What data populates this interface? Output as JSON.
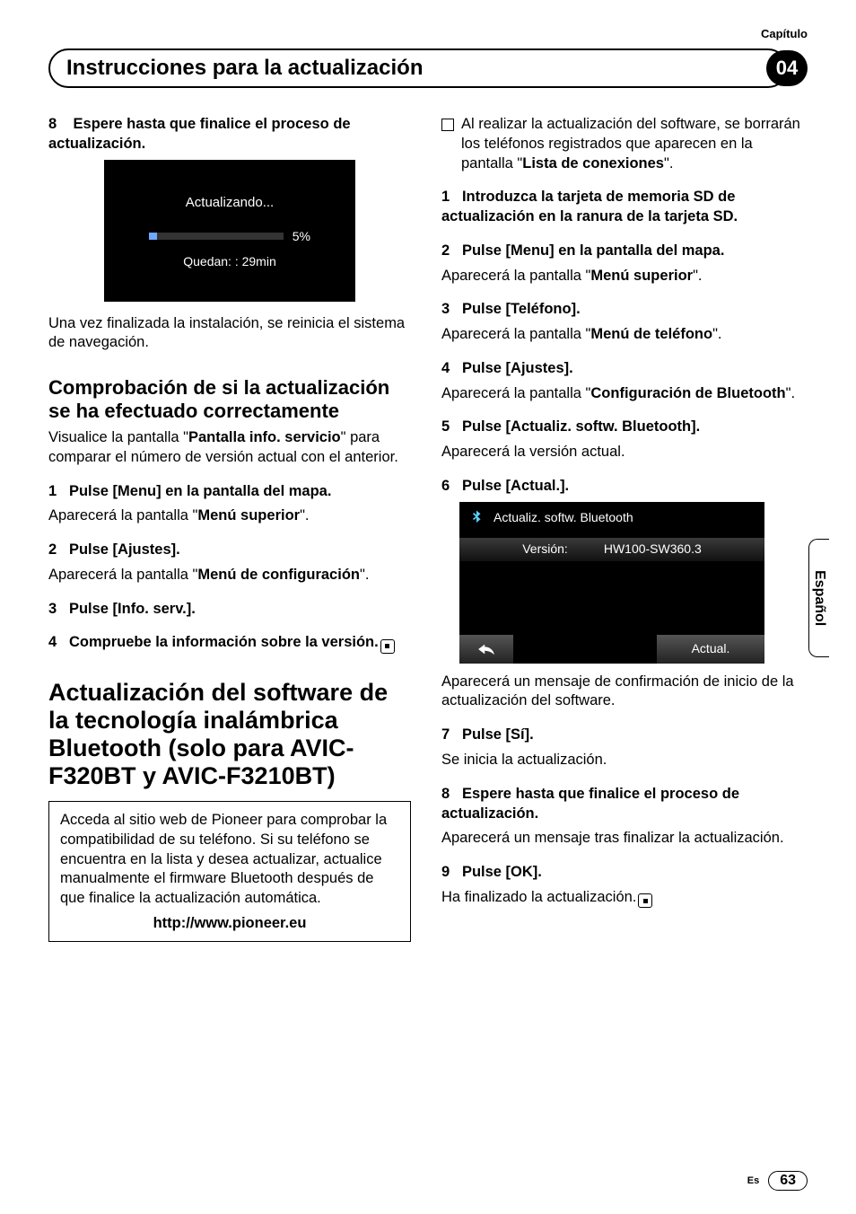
{
  "meta": {
    "capitulo_label": "Capítulo",
    "chapter_num": "04",
    "lang_tab": "Español",
    "footer_lang": "Es",
    "page_num": "63"
  },
  "header": {
    "title": "Instrucciones para la actualización"
  },
  "left": {
    "step8": {
      "num": "8",
      "title": "Espere hasta que finalice el proceso de actualización."
    },
    "shot1": {
      "updating": "Actualizando...",
      "percent": "5%",
      "remaining": "Quedan:  :  29min"
    },
    "after_shot1": "Una vez finalizada la instalación, se reinicia el sistema de navegación.",
    "h2": "Comprobación de si la actualización se ha efectuado correctamente",
    "h2_desc_a": "Visualice la pantalla \"",
    "h2_desc_b": "Pantalla info. servicio",
    "h2_desc_c": "\" para comparar el número de versión actual con el anterior.",
    "s1": {
      "num": "1",
      "title": "Pulse [Menu] en la pantalla del mapa.",
      "sub_a": "Aparecerá la pantalla \"",
      "sub_b": "Menú superior",
      "sub_c": "\"."
    },
    "s2": {
      "num": "2",
      "title": "Pulse [Ajustes].",
      "sub_a": "Aparecerá la pantalla \"",
      "sub_b": "Menú de configuración",
      "sub_c": "\"."
    },
    "s3": {
      "num": "3",
      "title": "Pulse [Info. serv.]."
    },
    "s4": {
      "num": "4",
      "title": "Compruebe la información sobre la versión."
    },
    "h1": "Actualización del software de la tecnología inalámbrica Bluetooth (solo para AVIC-F320BT y AVIC-F3210BT)",
    "box": {
      "text": "Acceda al sitio web de Pioneer para comprobar la compatibilidad de su teléfono. Si su teléfono se encuentra en la lista y desea actualizar, actualice manualmente el firmware Bluetooth después de que finalice la actualización automática.",
      "url": "http://www.pioneer.eu"
    }
  },
  "right": {
    "bullet_a": "Al realizar la actualización del software, se borrarán los teléfonos registrados que aparecen en la pantalla \"",
    "bullet_b": "Lista de conexiones",
    "bullet_c": "\".",
    "s1": {
      "num": "1",
      "title": "Introduzca la tarjeta de memoria SD de actualización en la ranura de la tarjeta SD."
    },
    "s2": {
      "num": "2",
      "title": "Pulse [Menu] en la pantalla del mapa.",
      "sub_a": "Aparecerá la pantalla \"",
      "sub_b": "Menú superior",
      "sub_c": "\"."
    },
    "s3": {
      "num": "3",
      "title": "Pulse [Teléfono].",
      "sub_a": "Aparecerá la pantalla \"",
      "sub_b": "Menú de teléfono",
      "sub_c": "\"."
    },
    "s4": {
      "num": "4",
      "title": "Pulse [Ajustes].",
      "sub_a": "Aparecerá la pantalla \"",
      "sub_b": "Configuración de Bluetooth",
      "sub_c": "\"."
    },
    "s5": {
      "num": "5",
      "title": "Pulse [Actualiz. softw. Bluetooth].",
      "sub": "Aparecerá la versión actual."
    },
    "s6": {
      "num": "6",
      "title": "Pulse [Actual.]."
    },
    "shot2": {
      "title": "Actualiz. softw. Bluetooth",
      "ver_label": "Versión:",
      "ver_value": "HW100-SW360.3",
      "actual": "Actual."
    },
    "after_shot2": "Aparecerá un mensaje de confirmación de inicio de la actualización del software.",
    "s7": {
      "num": "7",
      "title": "Pulse [Sí].",
      "sub": "Se inicia la actualización."
    },
    "s8": {
      "num": "8",
      "title": "Espere hasta que finalice el proceso de actualización.",
      "sub": "Aparecerá un mensaje tras finalizar la actualización."
    },
    "s9": {
      "num": "9",
      "title": "Pulse [OK].",
      "sub": "Ha finalizado la actualización."
    }
  }
}
